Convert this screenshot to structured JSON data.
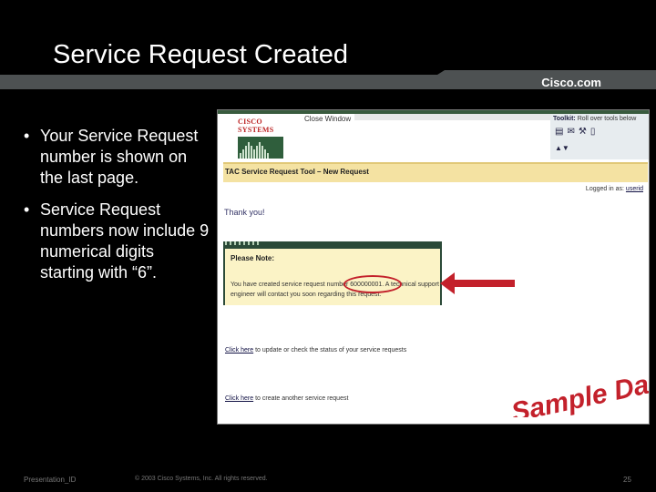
{
  "slide": {
    "title": "Service Request Created",
    "brand": "Cisco.com",
    "bullets": [
      "Your Service Request number is shown on the last page.",
      "Service Request numbers now include 9 numerical digits starting with “6”."
    ],
    "footer": {
      "left": "Presentation_ID",
      "center": "© 2003 Cisco Systems, Inc. All rights reserved.",
      "page": "25"
    },
    "watermark": "Sample Data"
  },
  "screenshot": {
    "logo_text": "CISCO SYSTEMS",
    "close_window": "Close Window",
    "toolkit": {
      "label": "Toolkit:",
      "text": "Roll over tools below"
    },
    "banner": "TAC Service Request Tool – New Request",
    "logged_in": {
      "prefix": "Logged in as:",
      "user": "userid"
    },
    "thank_you": "Thank you!",
    "note": {
      "title": "Please Note:",
      "text": "You have created service request number 600000001. A technical support engineer will contact you soon regarding this request.",
      "sr_number": "600000001"
    },
    "links": [
      {
        "link": "Click here",
        "text": "to update or check the status of your service requests"
      },
      {
        "link": "Click here",
        "text": "to create another service request"
      }
    ]
  },
  "colors": {
    "annotation_red": "#c3212b",
    "banner_yellow": "#f4e2a2",
    "note_yellow": "#fbf3c6",
    "frame_green": "#2b4a38"
  }
}
